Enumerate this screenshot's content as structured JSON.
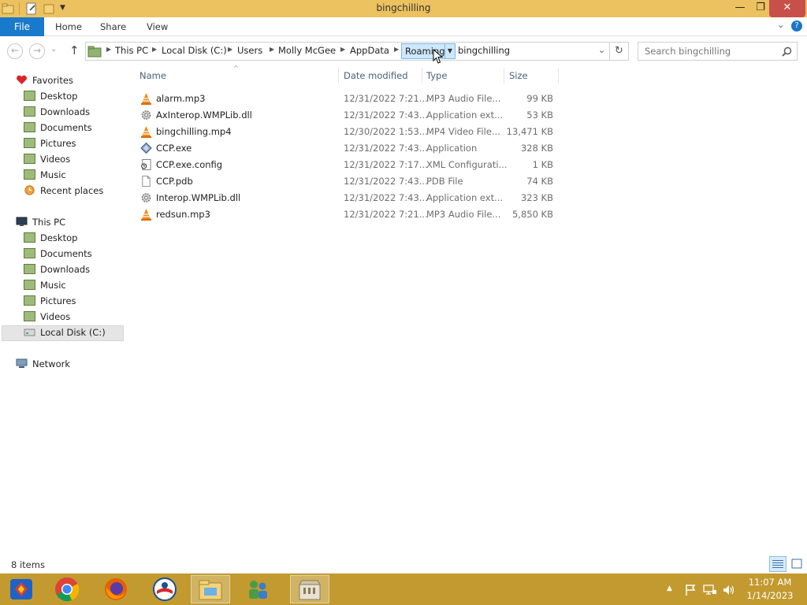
{
  "window": {
    "title": "bingchilling",
    "minimize_glyph": "—",
    "maximize_glyph": "❐",
    "close_glyph": "✕"
  },
  "ribbon": {
    "tabs": [
      "File",
      "Home",
      "Share",
      "View"
    ],
    "expand_glyph": "⌄",
    "help_glyph": "?"
  },
  "nav": {
    "back_glyph": "←",
    "forward_glyph": "→",
    "recent_glyph": "⌄",
    "up_glyph": "↑",
    "breadcrumb": [
      "This PC",
      "Local Disk (C:)",
      "Users",
      "Molly McGee",
      "AppData",
      "Roaming",
      "bingchilling"
    ],
    "refresh_glyph": "↻",
    "search_placeholder": "Search bingchilling"
  },
  "sidebar": {
    "favorites_label": "Favorites",
    "favorites": [
      "Desktop",
      "Downloads",
      "Documents",
      "Pictures",
      "Videos",
      "Music",
      "Recent places"
    ],
    "thispc_label": "This PC",
    "thispc": [
      "Desktop",
      "Documents",
      "Downloads",
      "Music",
      "Pictures",
      "Videos",
      "Local Disk (C:)"
    ],
    "network_label": "Network"
  },
  "columns": [
    "Name",
    "Date modified",
    "Type",
    "Size"
  ],
  "files": [
    {
      "name": "alarm.mp3",
      "date": "12/31/2022 7:21...",
      "type": "MP3 Audio File...",
      "size": "99 KB",
      "icon": "vlc-cone-icon"
    },
    {
      "name": "AxInterop.WMPLib.dll",
      "date": "12/31/2022 7:43...",
      "type": "Application ext...",
      "size": "53 KB",
      "icon": "gear-dll-icon"
    },
    {
      "name": "bingchilling.mp4",
      "date": "12/30/2022 1:53...",
      "type": "MP4 Video File...",
      "size": "13,471 KB",
      "icon": "vlc-cone-icon"
    },
    {
      "name": "CCP.exe",
      "date": "12/31/2022 7:43...",
      "type": "Application",
      "size": "328 KB",
      "icon": "exe-icon"
    },
    {
      "name": "CCP.exe.config",
      "date": "12/31/2022 7:17...",
      "type": "XML Configurati...",
      "size": "1 KB",
      "icon": "config-file-icon"
    },
    {
      "name": "CCP.pdb",
      "date": "12/31/2022 7:43...",
      "type": "PDB File",
      "size": "74 KB",
      "icon": "blank-file-icon"
    },
    {
      "name": "Interop.WMPLib.dll",
      "date": "12/31/2022 7:43...",
      "type": "Application ext...",
      "size": "323 KB",
      "icon": "gear-dll-icon"
    },
    {
      "name": "redsun.mp3",
      "date": "12/31/2022 7:21...",
      "type": "MP3 Audio File...",
      "size": "5,850 KB",
      "icon": "vlc-cone-icon"
    }
  ],
  "status": {
    "item_count": "8 items"
  },
  "taskbar": {
    "apps": [
      "generic-app-icon",
      "chrome-icon",
      "firefox-icon",
      "campaign-logo-icon",
      "file-explorer-icon",
      "people-icon",
      "store-icon"
    ],
    "clock_time": "11:07 AM",
    "clock_date": "1/14/2023",
    "tray_up_glyph": "▲"
  }
}
